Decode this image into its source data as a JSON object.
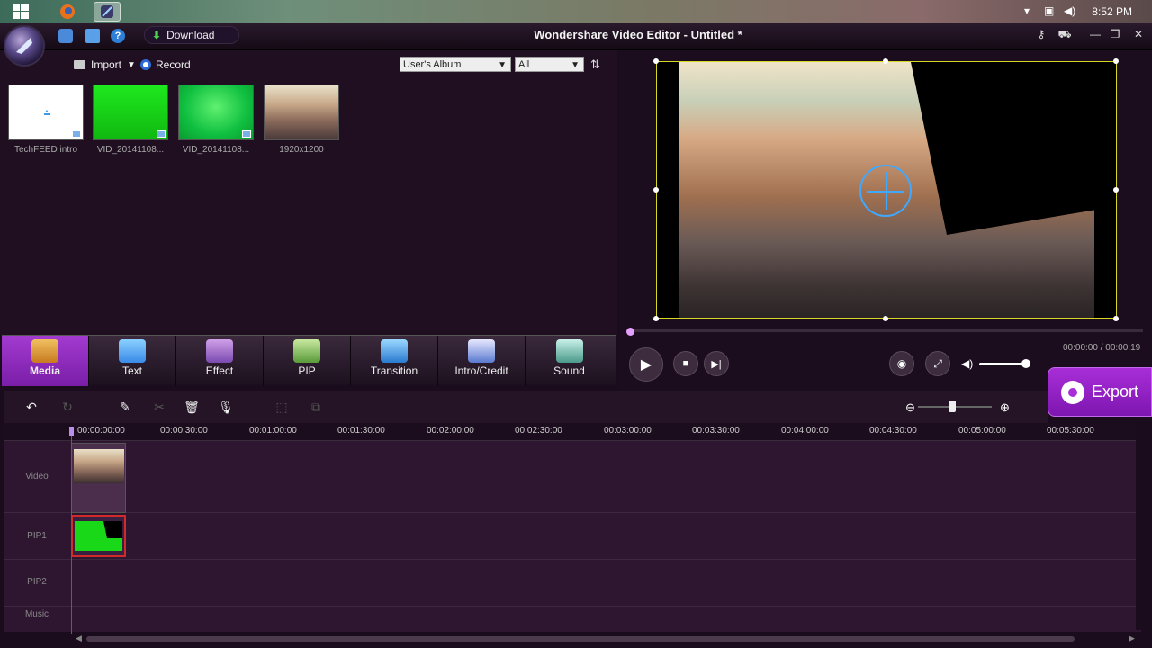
{
  "taskbar": {
    "clock": "8:52 PM"
  },
  "header": {
    "title": "Wondershare Video Editor - Untitled *",
    "download_label": "Download",
    "help_label": "?"
  },
  "media": {
    "import_label": "Import",
    "record_label": "Record",
    "album_select": "User's Album",
    "filter_select": "All",
    "items": [
      {
        "label": "TechFEED intro"
      },
      {
        "label": "VID_20141108..."
      },
      {
        "label": "VID_20141108..."
      },
      {
        "label": "1920x1200"
      }
    ]
  },
  "tabs": [
    {
      "label": "Media",
      "icon": "media-icon",
      "active": true
    },
    {
      "label": "Text",
      "icon": "text-icon"
    },
    {
      "label": "Effect",
      "icon": "effect-icon"
    },
    {
      "label": "PIP",
      "icon": "pip-icon"
    },
    {
      "label": "Transition",
      "icon": "transition-icon"
    },
    {
      "label": "Intro/Credit",
      "icon": "intro-credit-icon"
    },
    {
      "label": "Sound",
      "icon": "sound-icon"
    }
  ],
  "player": {
    "timecode": "00:00:00 / 00:00:19",
    "export_label": "Export",
    "volume_level": 0.9
  },
  "timeline": {
    "ruler": [
      "00:00:00:00",
      "00:00:30:00",
      "00:01:00:00",
      "00:01:30:00",
      "00:02:00:00",
      "00:02:30:00",
      "00:03:00:00",
      "00:03:30:00",
      "00:04:00:00",
      "00:04:30:00",
      "00:05:00:00",
      "00:05:30:00"
    ],
    "tracks": [
      "Video",
      "PIP1",
      "PIP2",
      "Music"
    ]
  },
  "colors": {
    "accent": "#a23ad0",
    "selection": "#d8d820",
    "pip_green": "#1ed21e",
    "playhead": "#e22233"
  }
}
